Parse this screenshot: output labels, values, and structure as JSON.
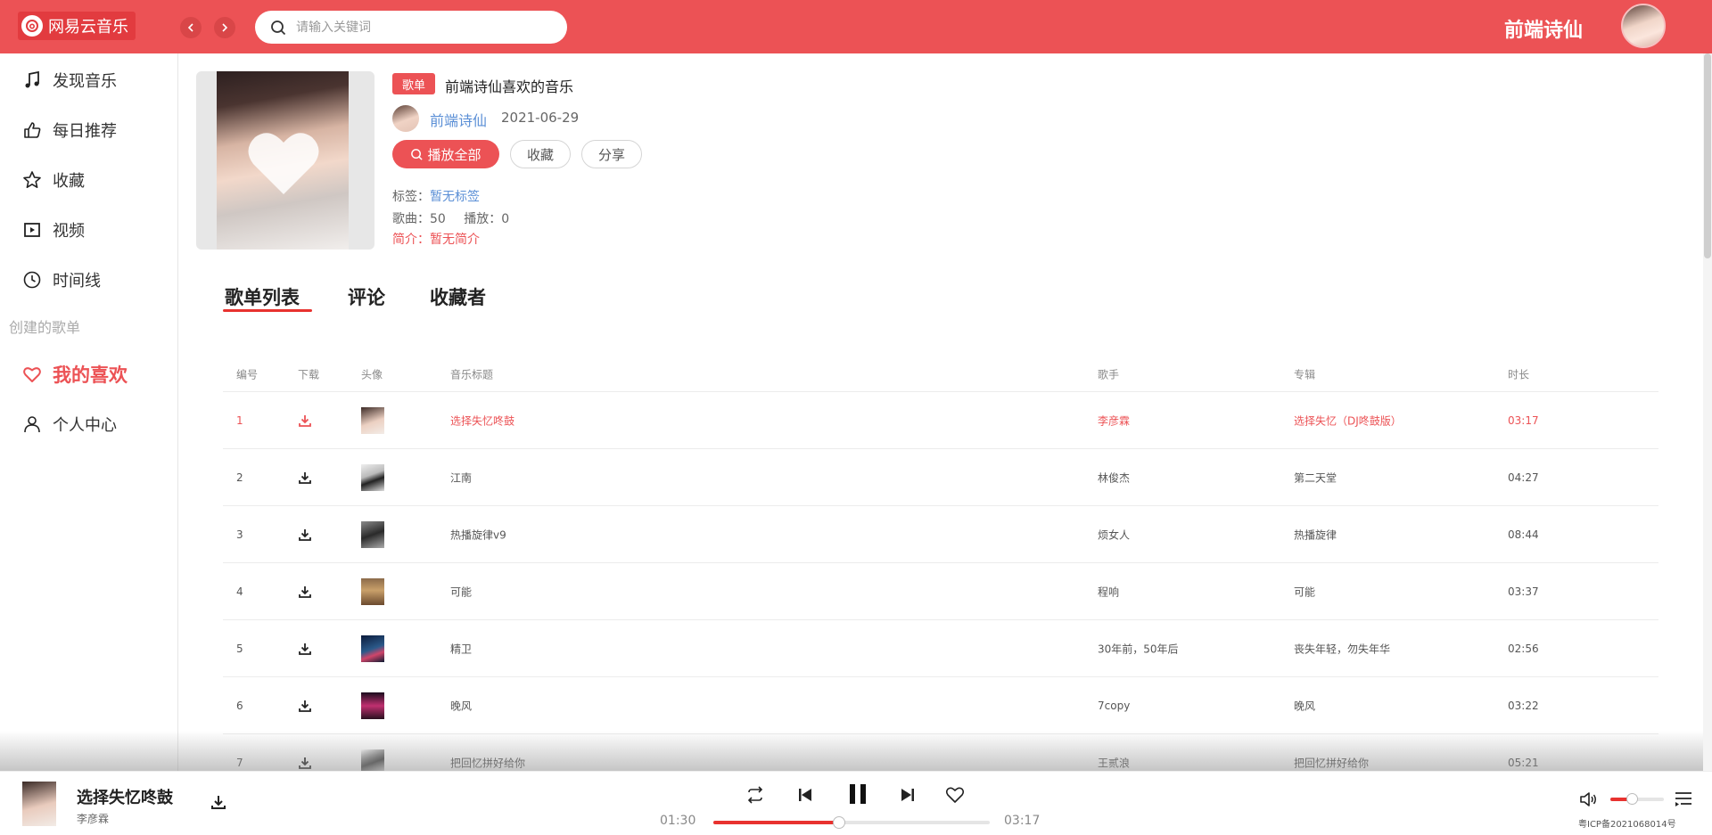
{
  "app": {
    "logo_text": "网易云音乐",
    "accent": "#ec5255"
  },
  "header": {
    "search_placeholder": "请输入关键词",
    "user_name": "前端诗仙"
  },
  "sidebar": {
    "items": [
      {
        "label": "发现音乐",
        "icon": "music-note-icon"
      },
      {
        "label": "每日推荐",
        "icon": "thumbs-up-icon"
      },
      {
        "label": "收藏",
        "icon": "star-icon"
      },
      {
        "label": "视频",
        "icon": "video-icon"
      },
      {
        "label": "时间线",
        "icon": "clock-icon"
      }
    ],
    "section_label": "创建的歌单",
    "my_likes": "我的喜欢",
    "profile": "个人中心"
  },
  "playlist": {
    "badge": "歌单",
    "title": "前端诗仙喜欢的音乐",
    "creator": "前端诗仙",
    "date": "2021-06-29",
    "play_all": "播放全部",
    "collect": "收藏",
    "share": "分享",
    "tags_label": "标签：",
    "tags_value": "暂无标签",
    "songs_label": "歌曲：",
    "songs_count": "50",
    "plays_label": "播放：",
    "plays_count": "0",
    "intro_label": "简介：",
    "intro_value": "暂无简介"
  },
  "tabs": [
    "歌单列表",
    "评论",
    "收藏者"
  ],
  "table": {
    "headers": {
      "no": "编号",
      "download": "下载",
      "cover": "头像",
      "title": "音乐标题",
      "artist": "歌手",
      "album": "专辑",
      "duration": "时长"
    },
    "rows": [
      {
        "no": "1",
        "title": "选择失忆咚鼓",
        "artist": "李彦霖",
        "album": "选择失忆（DJ咚鼓版）",
        "duration": "03:17",
        "playing": true
      },
      {
        "no": "2",
        "title": "江南",
        "artist": "林俊杰",
        "album": "第二天堂",
        "duration": "04:27"
      },
      {
        "no": "3",
        "title": "热播旋律v9",
        "artist": "烦女人",
        "album": "热播旋律",
        "duration": "08:44"
      },
      {
        "no": "4",
        "title": "可能",
        "artist": "程响",
        "album": "可能",
        "duration": "03:37"
      },
      {
        "no": "5",
        "title": "精卫",
        "artist": "30年前，50年后",
        "album": "丧失年轻，勿失年华",
        "duration": "02:56"
      },
      {
        "no": "6",
        "title": "晚风",
        "artist": "7copy",
        "album": "晚风",
        "duration": "03:22"
      },
      {
        "no": "7",
        "title": "把回忆拼好给你",
        "artist": "王贰浪",
        "album": "把回忆拼好给你",
        "duration": "05:21"
      }
    ]
  },
  "player": {
    "title": "选择失忆咚鼓",
    "artist": "李彦霖",
    "current_time": "01:30",
    "total_time": "03:17",
    "progress_fraction": 0.456,
    "volume_fraction": 0.4,
    "icp": "粤ICP备2021068014号"
  }
}
